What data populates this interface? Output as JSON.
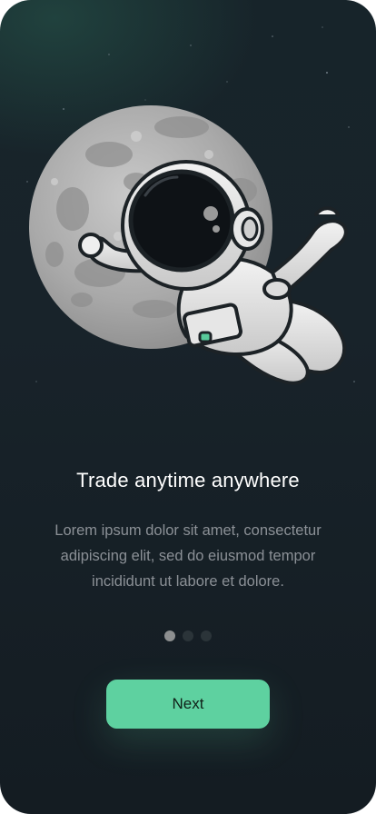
{
  "onboarding": {
    "title": "Trade anytime anywhere",
    "description": "Lorem ipsum dolor sit amet, consectetur adipiscing elit, sed do eiusmod tempor incididunt ut labore et dolore.",
    "next_label": "Next",
    "pagination": {
      "total": 3,
      "active": 1
    },
    "illustration_icon": "astronaut-moon-icon"
  },
  "colors": {
    "background": "#18232a",
    "accent": "#5ed1a0",
    "title": "#ffffff",
    "description": "#8b9096",
    "dot_active": "#8d8f90",
    "dot_inactive": "#2b3439"
  }
}
